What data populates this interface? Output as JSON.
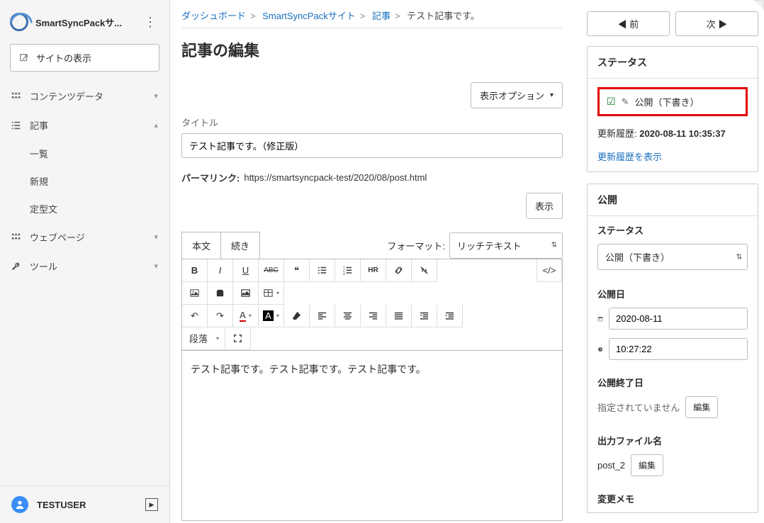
{
  "sidebar": {
    "site_title": "SmartSyncPackサ...",
    "site_view": "サイトの表示",
    "contents_data": "コンテンツデータ",
    "article": "記事",
    "items": [
      {
        "label": "一覧"
      },
      {
        "label": "新規"
      },
      {
        "label": "定型文"
      }
    ],
    "webpage": "ウェブページ",
    "tools": "ツール",
    "username": "TESTUSER"
  },
  "breadcrumb": {
    "dashboard": "ダッシュボード",
    "site": "SmartSyncPackサイト",
    "articles": "記事",
    "current": "テスト記事です。"
  },
  "page_title": "記事の編集",
  "display_options": "表示オプション",
  "title_label": "タイトル",
  "title_value": "テスト記事です。（修正版）",
  "permalink_label": "パーマリンク:",
  "permalink_value": "https://smartsyncpack-test/2020/08/post.html",
  "view_btn": "表示",
  "tabs": {
    "body": "本文",
    "more": "続き"
  },
  "format_label": "フォーマット:",
  "format_value": "リッチテキスト",
  "paragraph_label": "段落",
  "editor_text": "テスト記事です。テスト記事です。テスト記事です。",
  "nav": {
    "prev": "前",
    "next": "次"
  },
  "status_panel": {
    "header": "ステータス",
    "status_text": "公開（下書き）",
    "history_label": "更新履歴:",
    "history_value": "2020-08-11 10:35:37",
    "history_link": "更新履歴を表示"
  },
  "publish_panel": {
    "header": "公開",
    "status_sub": "ステータス",
    "status_select": "公開（下書き）",
    "pub_date_label": "公開日",
    "pub_date": "2020-08-11",
    "pub_time": "10:27:22",
    "end_label": "公開終了日",
    "end_value": "指定されていません",
    "edit_btn": "編集",
    "outfile_label": "出力ファイル名",
    "outfile_value": "post_2",
    "memo_label": "変更メモ"
  }
}
